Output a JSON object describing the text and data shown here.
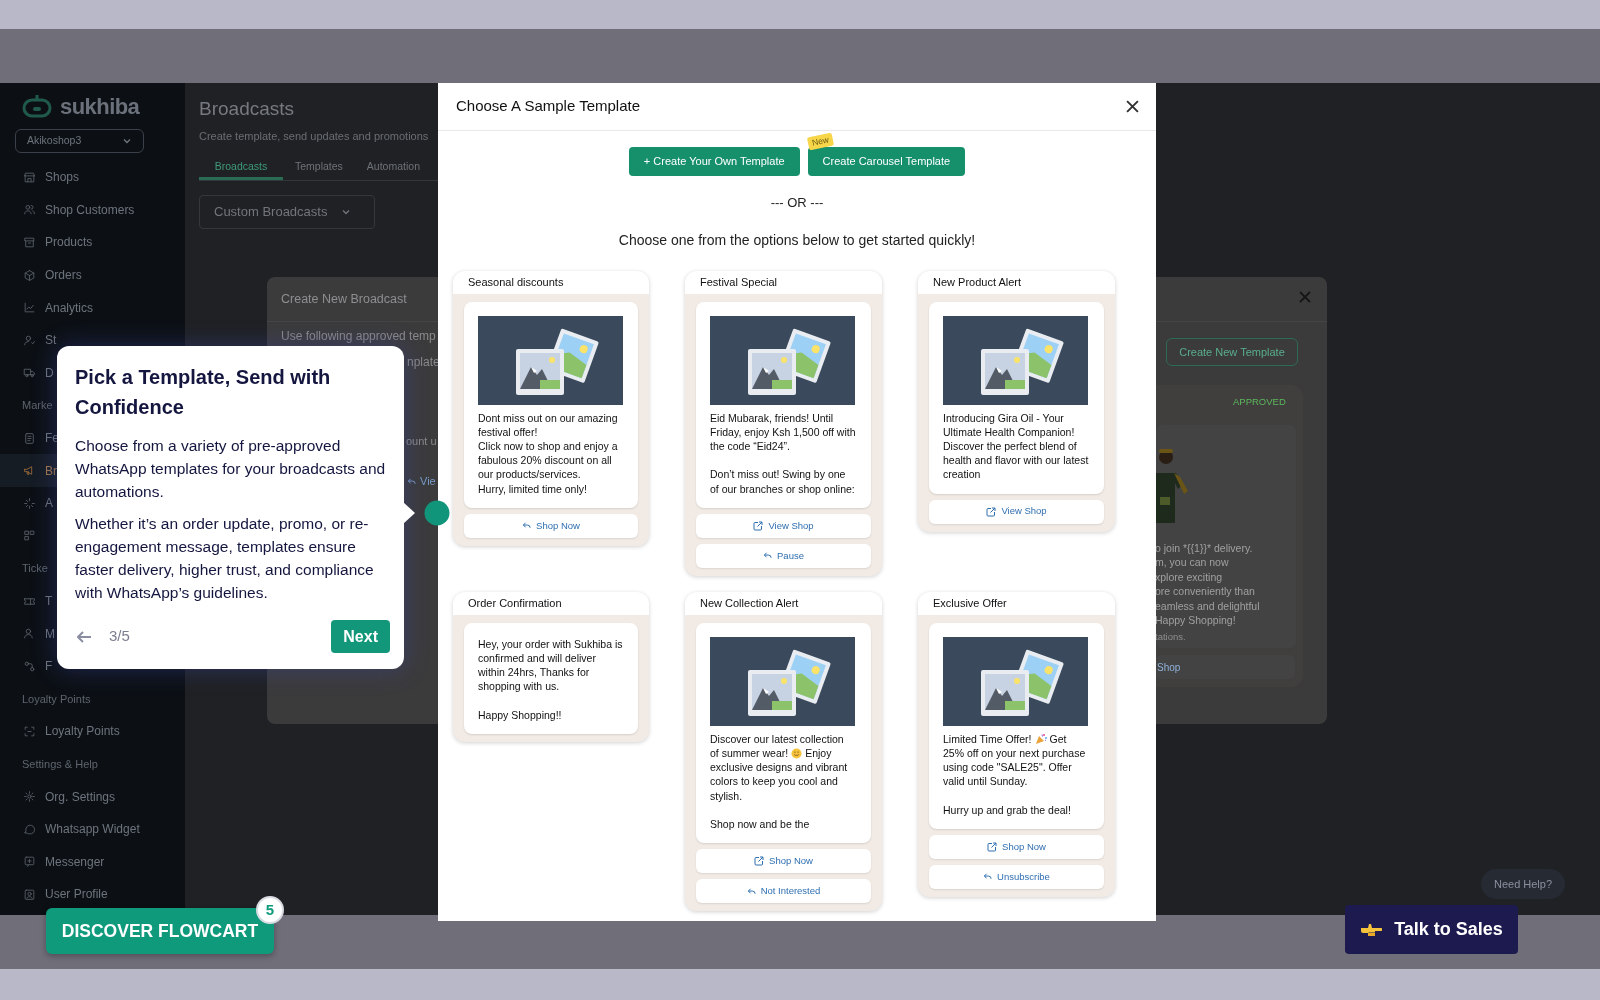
{
  "sidebar": {
    "logo": "sukhiba",
    "shop_selector": "Akikoshop3",
    "items": [
      {
        "kind": "item",
        "label": "Shops",
        "selected": false
      },
      {
        "kind": "item",
        "label": "Shop Customers",
        "selected": false
      },
      {
        "kind": "item",
        "label": "Products",
        "selected": false
      },
      {
        "kind": "item",
        "label": "Orders",
        "selected": false
      },
      {
        "kind": "item",
        "label": "Analytics",
        "selected": false
      },
      {
        "kind": "item",
        "label": "St",
        "selected": false
      },
      {
        "kind": "item",
        "label": "D",
        "selected": false
      },
      {
        "kind": "section",
        "label": "Marke"
      },
      {
        "kind": "item",
        "label": "Fe",
        "selected": false
      },
      {
        "kind": "item",
        "label": "Br",
        "selected": true
      },
      {
        "kind": "item",
        "label": "A",
        "selected": false
      },
      {
        "kind": "item",
        "selected": false
      },
      {
        "kind": "section",
        "label": "Ticke"
      },
      {
        "kind": "item",
        "label": "T",
        "selected": false
      },
      {
        "kind": "item",
        "label": "M",
        "selected": false
      },
      {
        "kind": "item",
        "label": "F",
        "selected": false
      },
      {
        "kind": "section",
        "label": "Loyalty Points"
      },
      {
        "kind": "item",
        "label": "Loyalty Points",
        "selected": false
      },
      {
        "kind": "section",
        "label": "Settings & Help"
      },
      {
        "kind": "item",
        "label": "Org. Settings",
        "selected": false
      },
      {
        "kind": "item",
        "label": "Whatsapp Widget",
        "selected": false
      },
      {
        "kind": "item",
        "label": "Messenger",
        "selected": false
      },
      {
        "kind": "item",
        "label": "User Profile",
        "selected": false
      }
    ]
  },
  "page": {
    "title": "Broadcasts",
    "subtitle": "Create template, send updates and promotions",
    "tabs": [
      {
        "label": "Broadcasts",
        "selected": true
      },
      {
        "label": "Templates",
        "selected": false
      },
      {
        "label": "Automation",
        "selected": false
      }
    ],
    "dropdown": "Custom Broadcasts"
  },
  "background_dialog": {
    "title": "Create New Broadcast",
    "intro_line": "Use following approved temp",
    "intro_fragment": "nplate",
    "row_fragment": "ount u",
    "link_fragment": "Vie",
    "create_button": "Create New Template",
    "template_status": "APPROVED",
    "template_lines": [
      "o join *{{1}}* delivery.",
      "m, you can now",
      "xplore exciting",
      "ore conveniently than",
      "eamless and delightful",
      "Happy Shopping!"
    ],
    "template_footer": "tations.",
    "template_button": "Shop"
  },
  "dialog": {
    "title": "Choose A Sample Template",
    "buttons": [
      {
        "label": "+ Create Your Own Template"
      },
      {
        "label": "Create Carousel Template",
        "badge": "New"
      }
    ],
    "separator": "--- OR ---",
    "prompt": "Choose one from the options below to get started quickly!",
    "templates": [
      {
        "title": "Seasonal discounts",
        "has_image": true,
        "message": [
          [
            {
              "kind": "text",
              "text": "Dont miss out on our amazing festival offer!\nClick now to shop and enjoy a fabulous 20% discount on all our products/services.\nHurry, limited time only!"
            }
          ]
        ],
        "buttons": [
          {
            "kind": "reply",
            "label": "Shop Now"
          }
        ]
      },
      {
        "title": "Festival Special",
        "has_image": true,
        "message": [
          [
            {
              "kind": "text",
              "text": "Eid Mubarak, friends! Until Friday, enjoy Ksh 1,500 off with the code “Eid24”.\n\nDon’t miss out! Swing by one of our branches or shop online:"
            }
          ]
        ],
        "buttons": [
          {
            "kind": "link",
            "label": "View Shop"
          },
          {
            "kind": "reply",
            "label": "Pause"
          }
        ]
      },
      {
        "title": "New Product Alert",
        "has_image": true,
        "message": [
          [
            {
              "kind": "text",
              "text": "Introducing Gira Oil - Your Ultimate Health Companion! Discover the perfect blend of health and flavor with our latest creation"
            }
          ]
        ],
        "buttons": [
          {
            "kind": "link",
            "label": "View Shop"
          }
        ]
      },
      {
        "title": "Order Confirmation",
        "has_image": false,
        "message": [
          [
            {
              "kind": "text",
              "text": "Hey, your order with Sukhiba is confirmed and will deliver within 24hrs, Thanks for shopping with us.\n\nHappy Shopping!!"
            }
          ]
        ]
      },
      {
        "title": "New Collection Alert",
        "has_image": true,
        "message": [
          [
            {
              "kind": "text",
              "text": "Discover our latest collection"
            }
          ],
          [
            {
              "kind": "text",
              "text": "of summer wear!"
            },
            {
              "kind": "smile-emoji"
            },
            {
              "kind": "text",
              "text": "Enjoy"
            }
          ],
          [
            {
              "kind": "text",
              "text": "exclusive designs and vibrant colors to keep you cool and stylish.\n\nShop now and be the"
            }
          ]
        ],
        "buttons": [
          {
            "kind": "link",
            "label": "Shop Now"
          },
          {
            "kind": "reply",
            "label": "Not Interested"
          }
        ]
      },
      {
        "title": "Exclusive Offer",
        "has_image": true,
        "message": [
          [
            {
              "kind": "text",
              "text": "Limited Time Offer!"
            },
            {
              "kind": "party-emoji"
            },
            {
              "kind": "text",
              "text": "Get"
            }
          ],
          [
            {
              "kind": "text",
              "text": "25% off on your next purchase using code \"SALE25\". Offer valid until Sunday.\n\nHurry up and grab the deal!"
            }
          ]
        ],
        "buttons": [
          {
            "kind": "link",
            "label": "Shop Now"
          },
          {
            "kind": "reply",
            "label": "Unsubscribe"
          }
        ]
      }
    ]
  },
  "tour": {
    "title": "Pick a Template, Send with Confidence",
    "paragraphs": [
      "Choose from a variety of pre-approved WhatsApp templates for your broadcasts and automations.",
      "Whether it’s an order update, promo, or re-engagement message, templates ensure faster delivery, higher trust, and compliance with WhatsApp’s guidelines."
    ],
    "step": "3/5",
    "next": "Next"
  },
  "discover": {
    "label": "DISCOVER FLOWCART",
    "count": "5"
  },
  "help": "Need Help?",
  "sales": {
    "label": "Talk to Sales"
  }
}
